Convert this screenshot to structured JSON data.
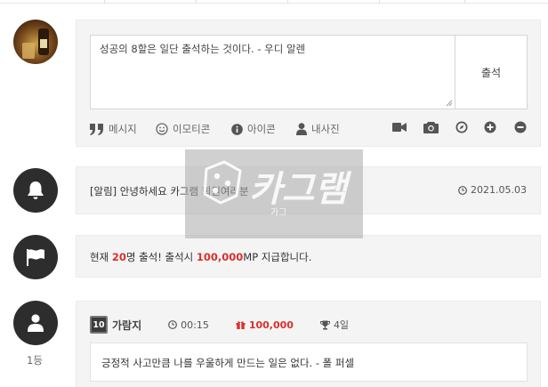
{
  "composer": {
    "message": "성공의 8할은 일단 출석하는 것이다. - 우디 알렌",
    "submit_label": "출석",
    "tools": [
      {
        "icon": "quote-icon",
        "label": "메시지"
      },
      {
        "icon": "smile-icon",
        "label": "이모티콘"
      },
      {
        "icon": "info-icon",
        "label": "아이콘"
      },
      {
        "icon": "user-icon",
        "label": "내사진"
      }
    ],
    "right_icons": [
      "video-icon",
      "camera-icon",
      "compass-icon",
      "plus-circle-icon",
      "minus-circle-icon"
    ]
  },
  "notice": {
    "text": "[알림] 안녕하세요 카그램 회원여러분",
    "date": "2021.05.03"
  },
  "attendance": {
    "prefix": "현재 ",
    "count": "20",
    "middle": "명 출석! 출석시 ",
    "points": "100,000",
    "suffix": "MP 지급합니다."
  },
  "comment": {
    "level": "10",
    "name": "가람지",
    "time": "00:15",
    "points": "100,000",
    "days": "4일",
    "text": "긍정적 사고만큼 나를 우울하게 만드는 일은 없다. - 폴 퍼셀",
    "rank": "1등"
  },
  "watermark": {
    "logo_text": "카그램",
    "sub_text": "가그"
  },
  "colors": {
    "accent_red": "#d9302c",
    "dark_avatar": "#2d2d2d",
    "panel_bg": "#f4f4f4"
  }
}
